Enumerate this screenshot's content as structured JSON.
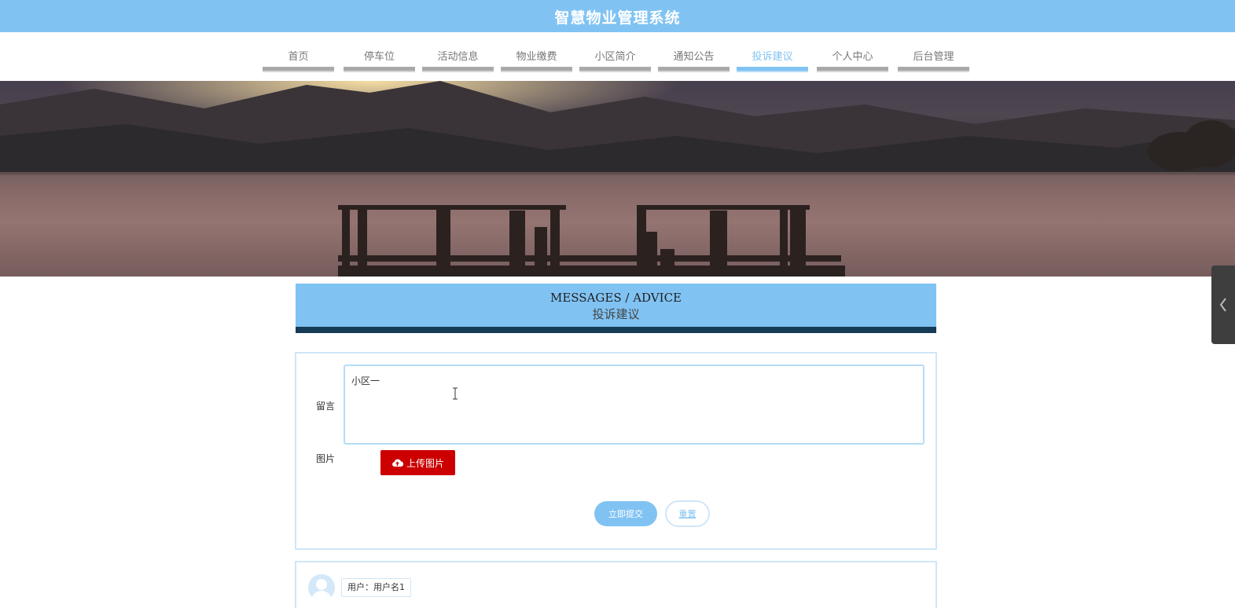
{
  "header": {
    "site_title": "智慧物业管理系统"
  },
  "nav": {
    "items": [
      {
        "label": "首页"
      },
      {
        "label": "停车位"
      },
      {
        "label": "活动信息"
      },
      {
        "label": "物业缴费"
      },
      {
        "label": "小区简介"
      },
      {
        "label": "通知公告"
      },
      {
        "label": "投诉建议"
      },
      {
        "label": "个人中心"
      },
      {
        "label": "后台管理"
      }
    ],
    "active_label": "投诉建议"
  },
  "section": {
    "title_en": "MESSAGES / ADVICE",
    "title_cn": "投诉建议"
  },
  "form": {
    "message_label": "留言",
    "message_value": "小区一",
    "image_label": "图片",
    "upload_button": "上传图片",
    "submit_button": "立即提交",
    "reset_button": "重置"
  },
  "comments": [
    {
      "user_label": "用户：用户名1"
    }
  ],
  "colors": {
    "primary": "#80c3f3",
    "dark_strip": "#163b55",
    "upload_red": "#cc0000"
  },
  "icons": {
    "upload": "cloud-upload-icon",
    "avatar": "user-avatar-icon",
    "side_toggle": "chevron-left-icon",
    "cursor": "text-cursor-icon"
  }
}
